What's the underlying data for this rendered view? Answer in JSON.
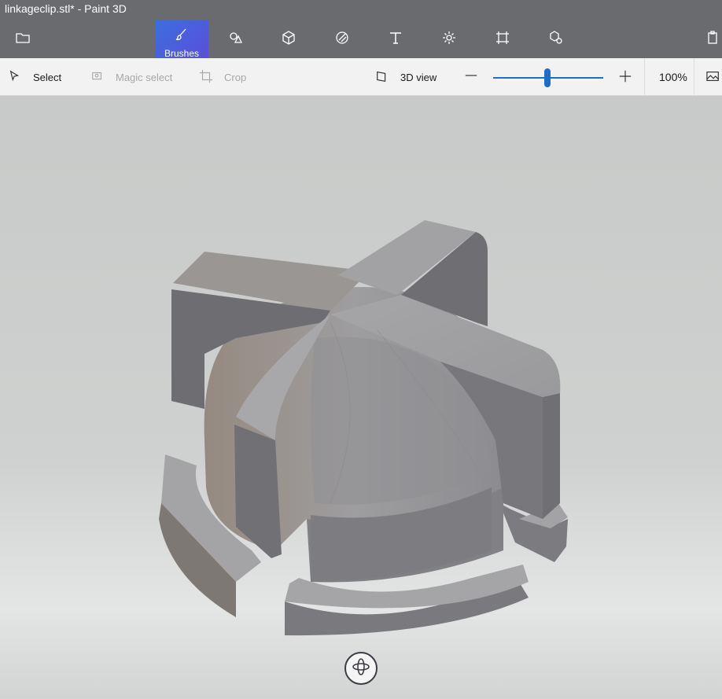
{
  "window": {
    "title": "linkageclip.stl* - Paint 3D"
  },
  "toolbar": {
    "tools": [
      {
        "id": "menu",
        "icon": "folder-icon"
      },
      {
        "id": "brushes",
        "icon": "brush-icon",
        "label": "Brushes",
        "active": true
      },
      {
        "id": "2d-shapes",
        "icon": "2d-shapes-icon"
      },
      {
        "id": "3d-shapes",
        "icon": "3d-shapes-icon"
      },
      {
        "id": "stickers",
        "icon": "stickers-icon"
      },
      {
        "id": "text",
        "icon": "text-icon"
      },
      {
        "id": "effects",
        "icon": "effects-icon"
      },
      {
        "id": "canvas",
        "icon": "canvas-icon"
      },
      {
        "id": "3d-library",
        "icon": "3d-library-icon"
      },
      {
        "id": "paste",
        "icon": "paste-icon"
      }
    ],
    "accent_color": "#4a63dd"
  },
  "subtoolbar": {
    "select_label": "Select",
    "magic_select_label": "Magic select",
    "crop_label": "Crop",
    "view_label": "3D view",
    "zoom_out": "—",
    "zoom_in": "+",
    "zoom_value": "100%",
    "zoom_fraction": 0.5
  },
  "canvas": {
    "model_color": "#8e8f92",
    "orbit_icon": "rotate-3d-icon"
  }
}
